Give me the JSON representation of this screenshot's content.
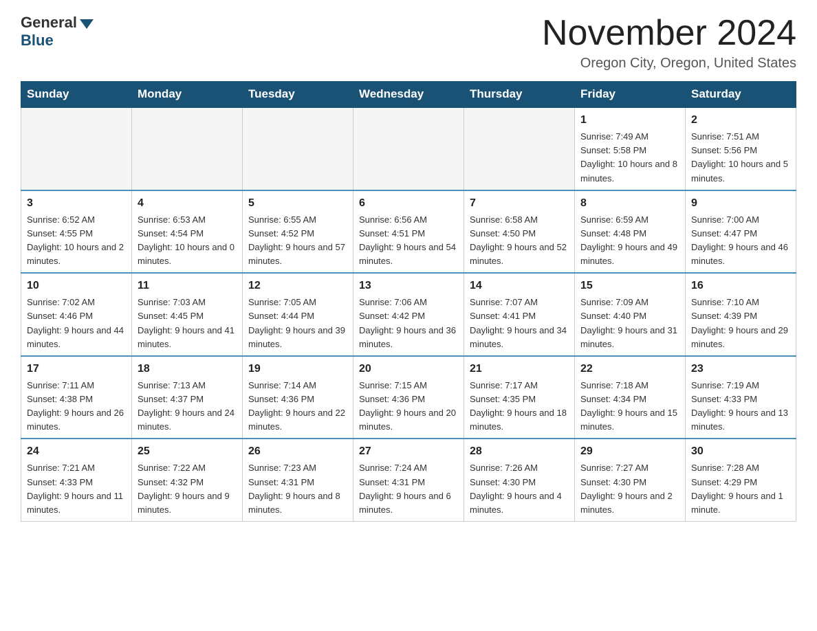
{
  "logo": {
    "general": "General",
    "blue": "Blue"
  },
  "title": "November 2024",
  "location": "Oregon City, Oregon, United States",
  "days_of_week": [
    "Sunday",
    "Monday",
    "Tuesday",
    "Wednesday",
    "Thursday",
    "Friday",
    "Saturday"
  ],
  "weeks": [
    [
      {
        "day": "",
        "info": ""
      },
      {
        "day": "",
        "info": ""
      },
      {
        "day": "",
        "info": ""
      },
      {
        "day": "",
        "info": ""
      },
      {
        "day": "",
        "info": ""
      },
      {
        "day": "1",
        "info": "Sunrise: 7:49 AM\nSunset: 5:58 PM\nDaylight: 10 hours\nand 8 minutes."
      },
      {
        "day": "2",
        "info": "Sunrise: 7:51 AM\nSunset: 5:56 PM\nDaylight: 10 hours\nand 5 minutes."
      }
    ],
    [
      {
        "day": "3",
        "info": "Sunrise: 6:52 AM\nSunset: 4:55 PM\nDaylight: 10 hours\nand 2 minutes."
      },
      {
        "day": "4",
        "info": "Sunrise: 6:53 AM\nSunset: 4:54 PM\nDaylight: 10 hours\nand 0 minutes."
      },
      {
        "day": "5",
        "info": "Sunrise: 6:55 AM\nSunset: 4:52 PM\nDaylight: 9 hours\nand 57 minutes."
      },
      {
        "day": "6",
        "info": "Sunrise: 6:56 AM\nSunset: 4:51 PM\nDaylight: 9 hours\nand 54 minutes."
      },
      {
        "day": "7",
        "info": "Sunrise: 6:58 AM\nSunset: 4:50 PM\nDaylight: 9 hours\nand 52 minutes."
      },
      {
        "day": "8",
        "info": "Sunrise: 6:59 AM\nSunset: 4:48 PM\nDaylight: 9 hours\nand 49 minutes."
      },
      {
        "day": "9",
        "info": "Sunrise: 7:00 AM\nSunset: 4:47 PM\nDaylight: 9 hours\nand 46 minutes."
      }
    ],
    [
      {
        "day": "10",
        "info": "Sunrise: 7:02 AM\nSunset: 4:46 PM\nDaylight: 9 hours\nand 44 minutes."
      },
      {
        "day": "11",
        "info": "Sunrise: 7:03 AM\nSunset: 4:45 PM\nDaylight: 9 hours\nand 41 minutes."
      },
      {
        "day": "12",
        "info": "Sunrise: 7:05 AM\nSunset: 4:44 PM\nDaylight: 9 hours\nand 39 minutes."
      },
      {
        "day": "13",
        "info": "Sunrise: 7:06 AM\nSunset: 4:42 PM\nDaylight: 9 hours\nand 36 minutes."
      },
      {
        "day": "14",
        "info": "Sunrise: 7:07 AM\nSunset: 4:41 PM\nDaylight: 9 hours\nand 34 minutes."
      },
      {
        "day": "15",
        "info": "Sunrise: 7:09 AM\nSunset: 4:40 PM\nDaylight: 9 hours\nand 31 minutes."
      },
      {
        "day": "16",
        "info": "Sunrise: 7:10 AM\nSunset: 4:39 PM\nDaylight: 9 hours\nand 29 minutes."
      }
    ],
    [
      {
        "day": "17",
        "info": "Sunrise: 7:11 AM\nSunset: 4:38 PM\nDaylight: 9 hours\nand 26 minutes."
      },
      {
        "day": "18",
        "info": "Sunrise: 7:13 AM\nSunset: 4:37 PM\nDaylight: 9 hours\nand 24 minutes."
      },
      {
        "day": "19",
        "info": "Sunrise: 7:14 AM\nSunset: 4:36 PM\nDaylight: 9 hours\nand 22 minutes."
      },
      {
        "day": "20",
        "info": "Sunrise: 7:15 AM\nSunset: 4:36 PM\nDaylight: 9 hours\nand 20 minutes."
      },
      {
        "day": "21",
        "info": "Sunrise: 7:17 AM\nSunset: 4:35 PM\nDaylight: 9 hours\nand 18 minutes."
      },
      {
        "day": "22",
        "info": "Sunrise: 7:18 AM\nSunset: 4:34 PM\nDaylight: 9 hours\nand 15 minutes."
      },
      {
        "day": "23",
        "info": "Sunrise: 7:19 AM\nSunset: 4:33 PM\nDaylight: 9 hours\nand 13 minutes."
      }
    ],
    [
      {
        "day": "24",
        "info": "Sunrise: 7:21 AM\nSunset: 4:33 PM\nDaylight: 9 hours\nand 11 minutes."
      },
      {
        "day": "25",
        "info": "Sunrise: 7:22 AM\nSunset: 4:32 PM\nDaylight: 9 hours\nand 9 minutes."
      },
      {
        "day": "26",
        "info": "Sunrise: 7:23 AM\nSunset: 4:31 PM\nDaylight: 9 hours\nand 8 minutes."
      },
      {
        "day": "27",
        "info": "Sunrise: 7:24 AM\nSunset: 4:31 PM\nDaylight: 9 hours\nand 6 minutes."
      },
      {
        "day": "28",
        "info": "Sunrise: 7:26 AM\nSunset: 4:30 PM\nDaylight: 9 hours\nand 4 minutes."
      },
      {
        "day": "29",
        "info": "Sunrise: 7:27 AM\nSunset: 4:30 PM\nDaylight: 9 hours\nand 2 minutes."
      },
      {
        "day": "30",
        "info": "Sunrise: 7:28 AM\nSunset: 4:29 PM\nDaylight: 9 hours\nand 1 minute."
      }
    ]
  ]
}
